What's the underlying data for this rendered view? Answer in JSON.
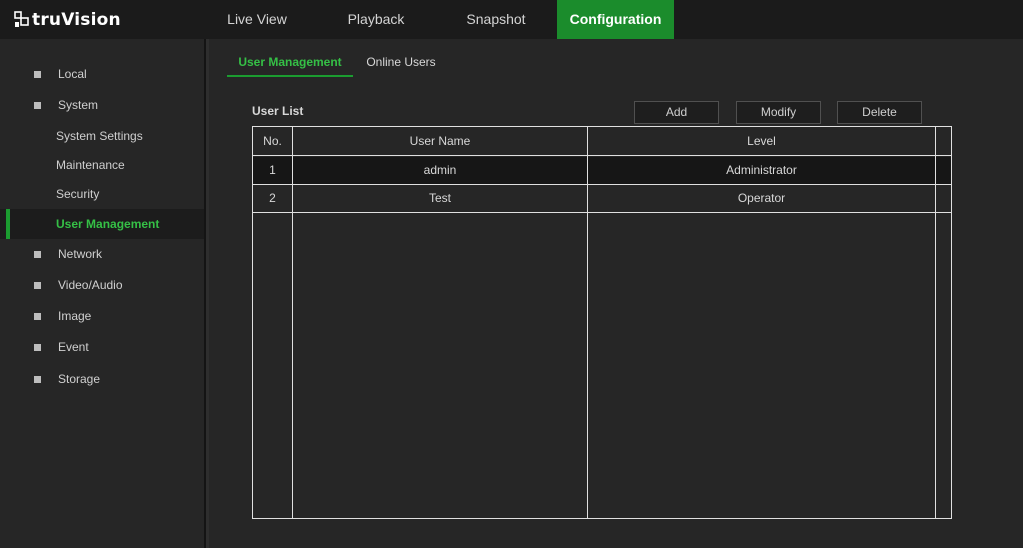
{
  "app": {
    "logo_text": "truVision"
  },
  "nav": {
    "tabs": [
      {
        "label": "Live View"
      },
      {
        "label": "Playback"
      },
      {
        "label": "Snapshot"
      },
      {
        "label": "Configuration",
        "active": true
      }
    ]
  },
  "sidebar": {
    "items": [
      {
        "label": "Local"
      },
      {
        "label": "System"
      },
      {
        "label": "System Settings"
      },
      {
        "label": "Maintenance"
      },
      {
        "label": "Security"
      },
      {
        "label": "User Management",
        "active": true
      },
      {
        "label": "Network"
      },
      {
        "label": "Video/Audio"
      },
      {
        "label": "Image"
      },
      {
        "label": "Event"
      },
      {
        "label": "Storage"
      }
    ]
  },
  "content": {
    "tabs": [
      {
        "label": "User Management",
        "active": true
      },
      {
        "label": "Online Users"
      }
    ],
    "section_title": "User List",
    "buttons": {
      "add": "Add",
      "modify": "Modify",
      "delete": "Delete"
    },
    "table": {
      "headers": [
        "No.",
        "User Name",
        "Level"
      ],
      "rows": [
        {
          "no": "1",
          "user_name": "admin",
          "level": "Administrator",
          "selected": true
        },
        {
          "no": "2",
          "user_name": "Test",
          "level": "Operator"
        }
      ]
    }
  },
  "colors": {
    "accent": "#1b8c2c",
    "accent_text": "#35c046",
    "background": "#262626",
    "topbar": "#1b1b1b"
  }
}
